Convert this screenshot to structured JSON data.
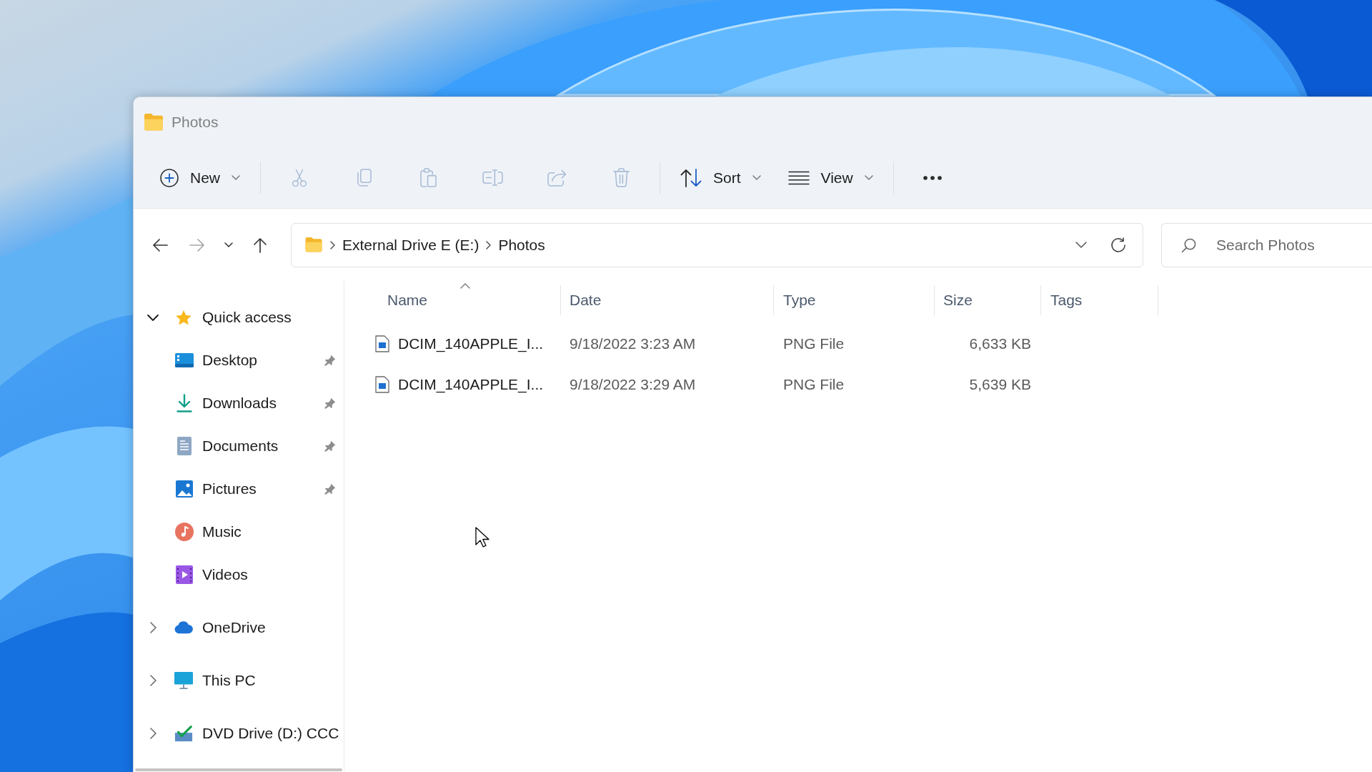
{
  "window": {
    "title": "Photos"
  },
  "toolbar": {
    "items": [
      {
        "kind": "new",
        "label": "New",
        "disabled": false
      },
      {
        "kind": "separator"
      },
      {
        "kind": "cut",
        "disabled": true
      },
      {
        "kind": "copy",
        "disabled": true
      },
      {
        "kind": "paste",
        "disabled": true
      },
      {
        "kind": "rename",
        "disabled": true
      },
      {
        "kind": "share",
        "disabled": true
      },
      {
        "kind": "delete",
        "disabled": true
      },
      {
        "kind": "separator"
      },
      {
        "kind": "sort",
        "label": "Sort",
        "disabled": false
      },
      {
        "kind": "view",
        "label": "View",
        "disabled": false
      },
      {
        "kind": "separator"
      },
      {
        "kind": "more",
        "disabled": false
      }
    ]
  },
  "navigation": {
    "buttons": [
      {
        "kind": "back",
        "disabled": false
      },
      {
        "kind": "forward",
        "disabled": true
      },
      {
        "kind": "recent",
        "disabled": false
      },
      {
        "kind": "up",
        "disabled": false
      }
    ]
  },
  "address_bar": {
    "path": [
      "External Drive E (E:)",
      "Photos"
    ]
  },
  "search": {
    "placeholder": "Search Photos"
  },
  "sidebar": {
    "items": [
      {
        "label": "Quick access",
        "kind": "star",
        "expanded": true,
        "children": [
          {
            "label": "Desktop",
            "kind": "desktop",
            "pinned": true
          },
          {
            "label": "Downloads",
            "kind": "downloads",
            "pinned": true
          },
          {
            "label": "Documents",
            "kind": "documents",
            "pinned": true
          },
          {
            "label": "Pictures",
            "kind": "pictures",
            "pinned": true
          },
          {
            "label": "Music",
            "kind": "music",
            "pinned": false
          },
          {
            "label": "Videos",
            "kind": "videos",
            "pinned": false
          }
        ]
      },
      {
        "label": "OneDrive",
        "kind": "cloud",
        "expanded": false
      },
      {
        "label": "This PC",
        "kind": "pc",
        "expanded": false
      },
      {
        "label": "DVD Drive (D:) CCC",
        "kind": "dvd",
        "expanded": false
      }
    ]
  },
  "file_list": {
    "columns": [
      {
        "label": "Name",
        "sorted": true
      },
      {
        "label": "Date",
        "sorted": false
      },
      {
        "label": "Type",
        "sorted": false
      },
      {
        "label": "Size",
        "sorted": false
      },
      {
        "label": "Tags",
        "sorted": false
      }
    ],
    "rows": [
      {
        "name": "DCIM_140APPLE_I...",
        "date": "9/18/2022 3:23 AM",
        "type": "PNG File",
        "size": "6,633 KB"
      },
      {
        "name": "DCIM_140APPLE_I...",
        "date": "9/18/2022 3:29 AM",
        "type": "PNG File",
        "size": "5,639 KB"
      }
    ]
  }
}
